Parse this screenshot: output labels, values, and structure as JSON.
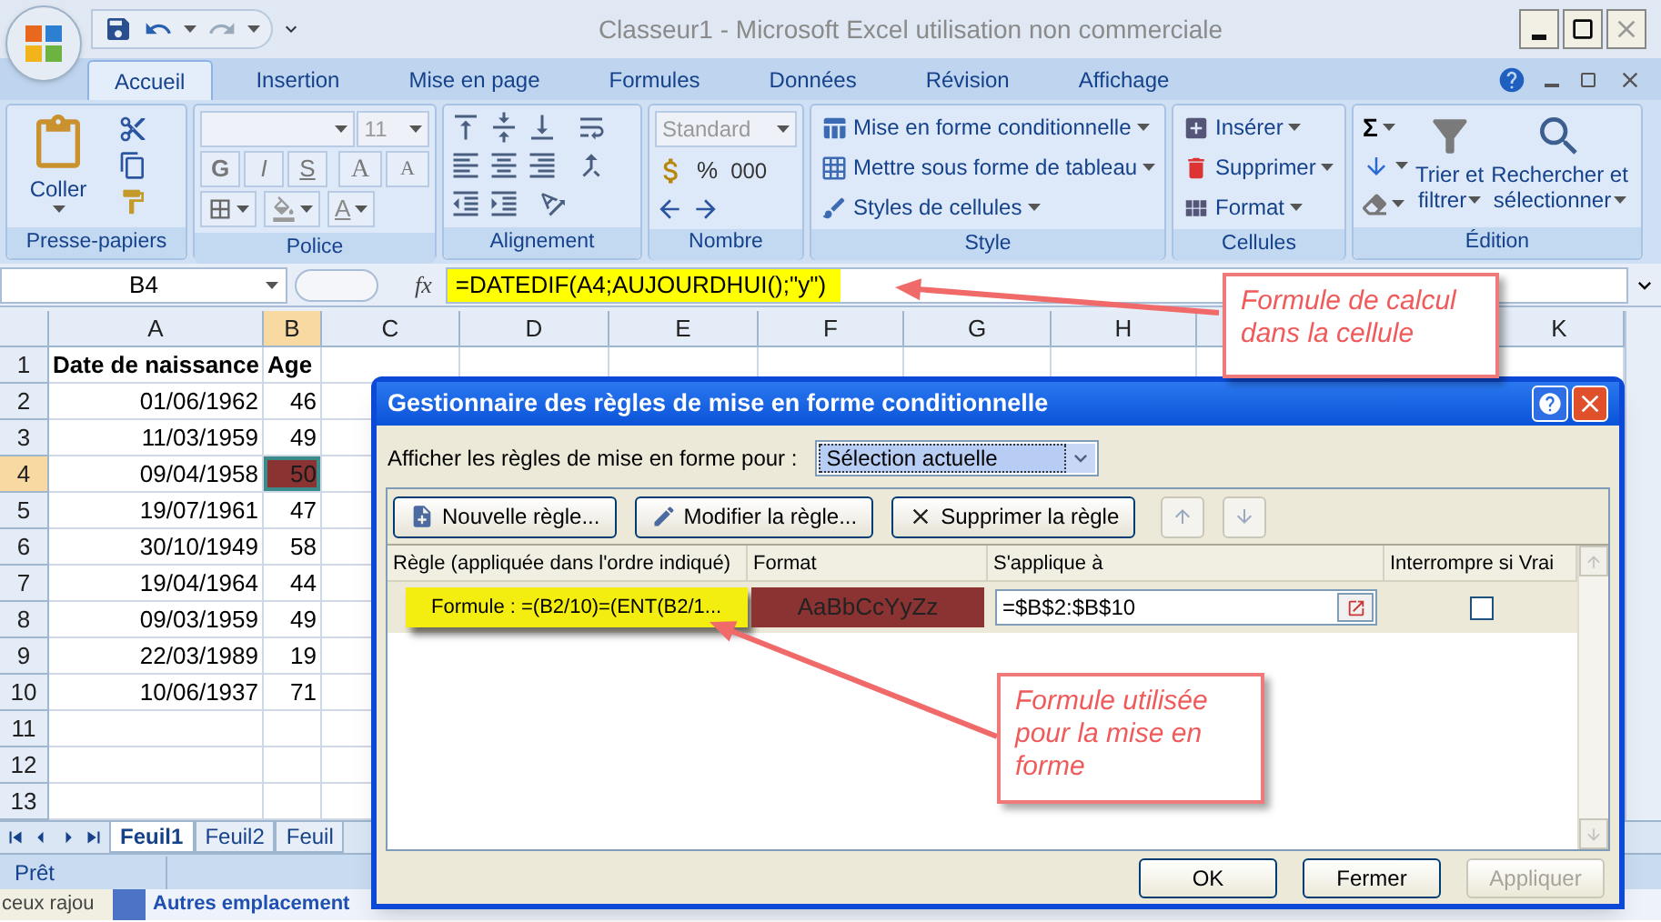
{
  "window": {
    "title": "Classeur1 - Microsoft Excel utilisation non commerciale"
  },
  "ribbon_tabs": [
    {
      "label": "Accueil",
      "selected": true
    },
    {
      "label": "Insertion",
      "selected": false
    },
    {
      "label": "Mise en page",
      "selected": false
    },
    {
      "label": "Formules",
      "selected": false
    },
    {
      "label": "Données",
      "selected": false
    },
    {
      "label": "Révision",
      "selected": false
    },
    {
      "label": "Affichage",
      "selected": false
    }
  ],
  "ribbon": {
    "clipboard": {
      "paste": "Coller",
      "group": "Presse-papiers"
    },
    "font": {
      "size": "11",
      "style_buttons": [
        "G",
        "I",
        "S"
      ],
      "grow": "A",
      "shrink": "A",
      "color_button": "A",
      "group": "Police"
    },
    "alignment": {
      "group": "Alignement"
    },
    "number": {
      "format": "Standard",
      "percent": "%",
      "thousands": "000",
      "group": "Nombre"
    },
    "style": {
      "items": [
        "Mise en forme conditionnelle",
        "Mettre sous forme de tableau",
        "Styles de cellules"
      ],
      "group": "Style"
    },
    "cells": {
      "items": [
        "Insérer",
        "Supprimer",
        "Format"
      ],
      "group": "Cellules"
    },
    "editing": {
      "sum": "Σ",
      "sort": [
        "Trier et",
        "filtrer"
      ],
      "find": [
        "Rechercher et",
        "sélectionner"
      ],
      "group": "Édition"
    }
  },
  "formula_bar": {
    "name_box": "B4",
    "fx": "fx",
    "formula": "=DATEDIF(A4;AUJOURDHUI();\"y\")"
  },
  "sheet": {
    "columns": [
      {
        "label": "A",
        "selected": false
      },
      {
        "label": "B",
        "selected": true
      },
      {
        "label": "C",
        "selected": false
      },
      {
        "label": "D",
        "selected": false
      },
      {
        "label": "E",
        "selected": false
      },
      {
        "label": "F",
        "selected": false
      },
      {
        "label": "G",
        "selected": false
      },
      {
        "label": "H",
        "selected": false
      },
      {
        "label": "K",
        "selected": false
      }
    ],
    "rows": [
      {
        "number": "1",
        "kind": "heading",
        "selected": false,
        "rule_match": false,
        "cells": [
          "Date de naissance",
          "Age"
        ]
      },
      {
        "number": "2",
        "kind": "data",
        "selected": false,
        "rule_match": false,
        "cells": [
          "01/06/1962",
          "46"
        ]
      },
      {
        "number": "3",
        "kind": "data",
        "selected": false,
        "rule_match": false,
        "cells": [
          "11/03/1959",
          "49"
        ]
      },
      {
        "number": "4",
        "kind": "data",
        "selected": true,
        "rule_match": true,
        "cells": [
          "09/04/1958",
          "50"
        ]
      },
      {
        "number": "5",
        "kind": "data",
        "selected": false,
        "rule_match": false,
        "cells": [
          "19/07/1961",
          "47"
        ]
      },
      {
        "number": "6",
        "kind": "data",
        "selected": false,
        "rule_match": false,
        "cells": [
          "30/10/1949",
          "58"
        ]
      },
      {
        "number": "7",
        "kind": "data",
        "selected": false,
        "rule_match": false,
        "cells": [
          "19/04/1964",
          "44"
        ]
      },
      {
        "number": "8",
        "kind": "data",
        "selected": false,
        "rule_match": false,
        "cells": [
          "09/03/1959",
          "49"
        ]
      },
      {
        "number": "9",
        "kind": "data",
        "selected": false,
        "rule_match": false,
        "cells": [
          "22/03/1989",
          "19"
        ]
      },
      {
        "number": "10",
        "kind": "data",
        "selected": false,
        "rule_match": false,
        "cells": [
          "10/06/1937",
          "71"
        ]
      },
      {
        "number": "11",
        "kind": "blank",
        "selected": false
      },
      {
        "number": "12",
        "kind": "blank",
        "selected": false
      },
      {
        "number": "13",
        "kind": "blank",
        "selected": false
      }
    ]
  },
  "sheet_tabs": [
    {
      "label": "Feuil1",
      "selected": true
    },
    {
      "label": "Feuil2",
      "selected": false
    },
    {
      "label": "Feuil",
      "selected": false
    }
  ],
  "status_bar": {
    "text": "Prêt"
  },
  "taskbar": {
    "left_text": "ceux rajou",
    "link": "Autres emplacement"
  },
  "dialog": {
    "title": "Gestionnaire des règles de mise en forme conditionnelle",
    "show_label": "Afficher les règles de mise en forme pour :",
    "show_value": "Sélection actuelle",
    "buttons": [
      {
        "label": "Nouvelle règle...",
        "kind": "new"
      },
      {
        "label": "Modifier la règle...",
        "kind": "edit"
      },
      {
        "label": "Supprimer la règle",
        "kind": "delete"
      }
    ],
    "columns": [
      "Règle (appliquée dans l'ordre indiqué)",
      "Format",
      "S'applique à",
      "Interrompre si Vrai"
    ],
    "rules": [
      {
        "rule": "Formule : =(B2/10)=(ENT(B2/1...",
        "preview": "AaBbCcYyZz",
        "applies_to": "=$B$2:$B$10",
        "stop_if_true": false
      }
    ],
    "footer_buttons": [
      {
        "label": "OK",
        "disabled": false
      },
      {
        "label": "Fermer",
        "disabled": false
      },
      {
        "label": "Appliquer",
        "disabled": true
      }
    ]
  },
  "callouts": [
    {
      "text": "Formule de calcul dans la cellule"
    },
    {
      "text": "Formule utilisée pour la mise en forme"
    }
  ]
}
